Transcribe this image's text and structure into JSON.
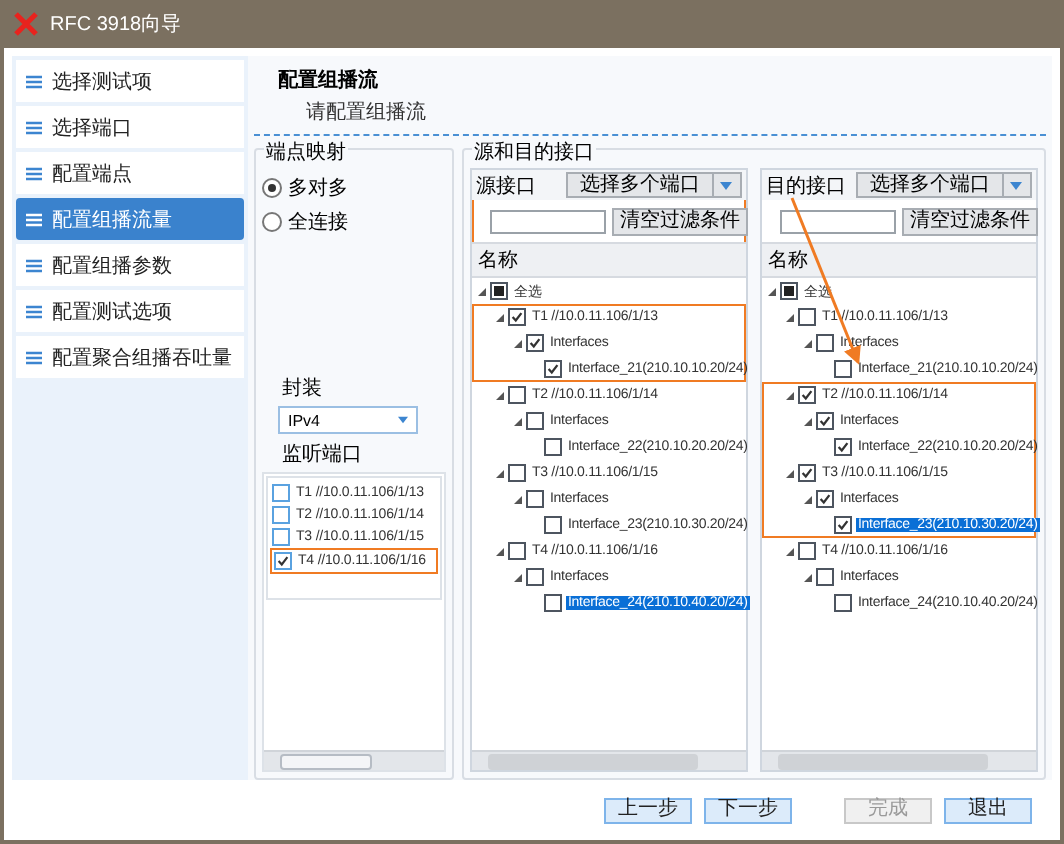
{
  "window": {
    "title": "RFC 3918向导"
  },
  "sidebar": {
    "items": [
      {
        "label": "选择测试项",
        "selected": false
      },
      {
        "label": "选择端口",
        "selected": false
      },
      {
        "label": "配置端点",
        "selected": false
      },
      {
        "label": "配置组播流量",
        "selected": true
      },
      {
        "label": "配置组播参数",
        "selected": false
      },
      {
        "label": "配置测试选项",
        "selected": false
      },
      {
        "label": "配置聚合组播吞吐量",
        "selected": false
      }
    ]
  },
  "header": {
    "title": "配置组播流",
    "subtitle": "请配置组播流"
  },
  "endpoint_mapping": {
    "legend": "端点映射",
    "radios": [
      {
        "label": "多对多",
        "selected": true
      },
      {
        "label": "全连接",
        "selected": false
      }
    ],
    "encapsulation_label": "封装",
    "encapsulation": "IPv4",
    "listen_label": "监听端口",
    "listen_ports": [
      {
        "label": "T1 //10.0.11.106/1/13",
        "checked": false,
        "highlighted": false
      },
      {
        "label": "T2 //10.0.11.106/1/14",
        "checked": false,
        "highlighted": false
      },
      {
        "label": "T3 //10.0.11.106/1/15",
        "checked": false,
        "highlighted": false
      },
      {
        "label": "T4 //10.0.11.106/1/16",
        "checked": true,
        "highlighted": true
      }
    ]
  },
  "interfaces": {
    "legend": "源和目的接口",
    "panels": [
      {
        "label": "源接口",
        "select_button": "选择多个端口",
        "clear_button": "清空过滤条件",
        "column": "名称",
        "header_highlighted": true,
        "arrow": false,
        "tree": [
          {
            "label": "全选",
            "checked": false,
            "mixed": true,
            "expanded": true,
            "selected": false,
            "children": [
              {
                "label": "T1 //10.0.11.106/1/13",
                "checked": true,
                "expanded": true,
                "selected": false,
                "highlighted": true,
                "children": [
                  {
                    "label": "Interfaces",
                    "checked": true,
                    "expanded": true,
                    "selected": false,
                    "children": [
                      {
                        "label": "Interface_21(210.10.10.20/24)",
                        "checked": true,
                        "selected": false
                      }
                    ]
                  }
                ]
              },
              {
                "label": "T2 //10.0.11.106/1/14",
                "checked": false,
                "expanded": true,
                "selected": false,
                "highlighted": false,
                "children": [
                  {
                    "label": "Interfaces",
                    "checked": false,
                    "expanded": true,
                    "selected": false,
                    "children": [
                      {
                        "label": "Interface_22(210.10.20.20/24)",
                        "checked": false,
                        "selected": false
                      }
                    ]
                  }
                ]
              },
              {
                "label": "T3 //10.0.11.106/1/15",
                "checked": false,
                "expanded": true,
                "selected": false,
                "highlighted": false,
                "children": [
                  {
                    "label": "Interfaces",
                    "checked": false,
                    "expanded": true,
                    "selected": false,
                    "children": [
                      {
                        "label": "Interface_23(210.10.30.20/24)",
                        "checked": false,
                        "selected": false
                      }
                    ]
                  }
                ]
              },
              {
                "label": "T4 //10.0.11.106/1/16",
                "checked": false,
                "expanded": true,
                "selected": false,
                "highlighted": false,
                "children": [
                  {
                    "label": "Interfaces",
                    "checked": false,
                    "expanded": true,
                    "selected": false,
                    "children": [
                      {
                        "label": "Interface_24(210.10.40.20/24)",
                        "checked": false,
                        "selected": true
                      }
                    ]
                  }
                ]
              }
            ]
          }
        ]
      },
      {
        "label": "目的接口",
        "select_button": "选择多个端口",
        "clear_button": "清空过滤条件",
        "column": "名称",
        "header_highlighted": false,
        "arrow": true,
        "tree": [
          {
            "label": "全选",
            "checked": false,
            "mixed": true,
            "expanded": true,
            "selected": false,
            "children": [
              {
                "label": "T1 //10.0.11.106/1/13",
                "checked": false,
                "expanded": true,
                "selected": false,
                "highlighted": false,
                "children": [
                  {
                    "label": "Interfaces",
                    "checked": false,
                    "expanded": true,
                    "selected": false,
                    "children": [
                      {
                        "label": "Interface_21(210.10.10.20/24)",
                        "checked": false,
                        "selected": false
                      }
                    ]
                  }
                ]
              },
              {
                "label": "T2 //10.0.11.106/1/14",
                "checked": true,
                "expanded": true,
                "selected": false,
                "highlighted": true,
                "children": [
                  {
                    "label": "Interfaces",
                    "checked": true,
                    "expanded": true,
                    "selected": false,
                    "children": [
                      {
                        "label": "Interface_22(210.10.20.20/24)",
                        "checked": true,
                        "selected": false
                      }
                    ]
                  }
                ]
              },
              {
                "label": "T3 //10.0.11.106/1/15",
                "checked": true,
                "expanded": true,
                "selected": false,
                "highlighted": true,
                "children": [
                  {
                    "label": "Interfaces",
                    "checked": true,
                    "expanded": true,
                    "selected": false,
                    "children": [
                      {
                        "label": "Interface_23(210.10.30.20/24)",
                        "checked": true,
                        "selected": true
                      }
                    ]
                  }
                ]
              },
              {
                "label": "T4 //10.0.11.106/1/16",
                "checked": false,
                "expanded": true,
                "selected": false,
                "highlighted": false,
                "children": [
                  {
                    "label": "Interfaces",
                    "checked": false,
                    "expanded": true,
                    "selected": false,
                    "children": [
                      {
                        "label": "Interface_24(210.10.40.20/24)",
                        "checked": false,
                        "selected": false
                      }
                    ]
                  }
                ]
              }
            ]
          }
        ]
      }
    ]
  },
  "buttons": [
    {
      "label": "上一步",
      "disabled": false
    },
    {
      "label": "下一步",
      "disabled": false
    },
    {
      "label": "完成",
      "disabled": true
    },
    {
      "label": "退出",
      "disabled": false
    }
  ]
}
